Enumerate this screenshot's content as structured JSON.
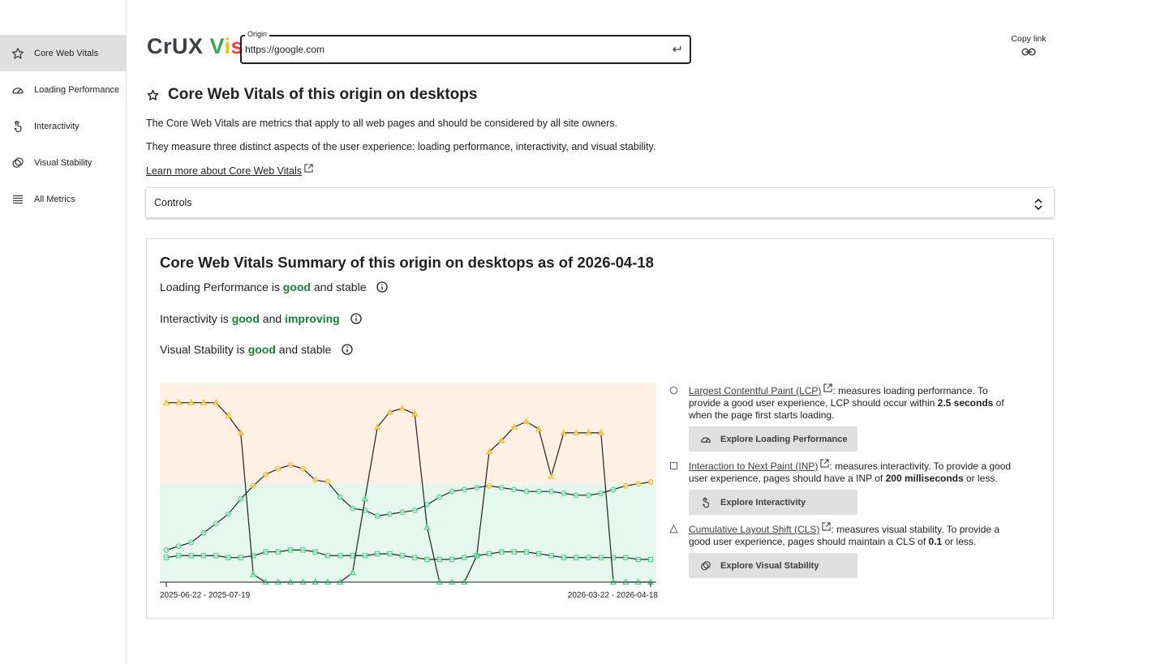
{
  "sidebar": {
    "items": [
      {
        "label": "Core Web Vitals",
        "icon": "star-icon",
        "active": true
      },
      {
        "label": "Loading Performance",
        "icon": "speedometer-icon"
      },
      {
        "label": "Interactivity",
        "icon": "touch-hand-icon"
      },
      {
        "label": "Visual Stability",
        "icon": "overlapping-circles-icon"
      },
      {
        "label": "All Metrics",
        "icon": "list-icon"
      }
    ]
  },
  "header": {
    "logo": {
      "part1": "CrUX ",
      "v": "V",
      "i": "i",
      "s": "s"
    },
    "origin_label": "Origin",
    "origin_value": "https://google.com",
    "copy_link_label": "Copy link"
  },
  "main": {
    "title": "Core Web Vitals of this origin on desktops",
    "para1": "The Core Web Vitals are metrics that apply to all web pages and should be considered by all site owners.",
    "para2": "They measure three distinct aspects of the user experience: loading performance, interactivity, and visual stability.",
    "learn_more": "Learn more about Core Web Vitals",
    "controls_label": "Controls"
  },
  "summary": {
    "title": "Core Web Vitals Summary of this origin on desktops as of 2026-04-18",
    "rows": [
      {
        "pre": "Loading Performance is ",
        "w1": "good",
        "mid": " and stable",
        "w2": ""
      },
      {
        "pre": "Interactivity is ",
        "w1": "good",
        "mid": " and ",
        "w2": "improving"
      },
      {
        "pre": "Visual Stability is ",
        "w1": "good",
        "mid": " and stable",
        "w2": ""
      }
    ]
  },
  "metrics": [
    {
      "link": "Largest Contentful Paint (LCP)",
      "t1": ": measures loading performance. To provide a good user experience, LCP should occur within ",
      "bold": "2.5 seconds",
      "t2": " of when the page first starts loading.",
      "button": "Explore Loading Performance",
      "marker": "circle"
    },
    {
      "link": "Interaction to Next Paint (INP)",
      "t1": ": measures interactivity. To provide a good user experience, pages should have a INP of ",
      "bold": "200 milliseconds",
      "t2": " or less.",
      "button": "Explore Interactivity",
      "marker": "square"
    },
    {
      "link": "Cumulative Layout Shift (CLS)",
      "t1": ": measures visual stability. To provide a good user experience, pages should maintain a CLS of ",
      "bold": "0.1",
      "t2": " or less.",
      "button": "Explore Visual Stability",
      "marker": "triangle"
    }
  ],
  "colors": {
    "good": "#188038",
    "good_band": "#e6f7ef",
    "needs_band": "#fdf1e6",
    "series_good": "#3ddc84",
    "series_warn": "#fbbc04"
  },
  "chart_data": {
    "type": "line",
    "x_first_label": "2025-06-22 - 2025-07-19",
    "x_last_label": "2026-03-22 - 2026-04-18",
    "num_points": 40,
    "series": [
      {
        "marker": "circle",
        "values": [
          0.17,
          0.19,
          0.21,
          0.26,
          0.31,
          0.36,
          0.44,
          0.51,
          0.57,
          0.6,
          0.62,
          0.6,
          0.54,
          0.53,
          0.45,
          0.39,
          0.38,
          0.35,
          0.36,
          0.37,
          0.38,
          0.41,
          0.45,
          0.48,
          0.49,
          0.5,
          0.51,
          0.5,
          0.49,
          0.48,
          0.48,
          0.48,
          0.47,
          0.46,
          0.46,
          0.47,
          0.49,
          0.51,
          0.52,
          0.53
        ]
      },
      {
        "marker": "square",
        "values": [
          0.13,
          0.14,
          0.14,
          0.14,
          0.14,
          0.13,
          0.13,
          0.14,
          0.16,
          0.16,
          0.17,
          0.17,
          0.16,
          0.14,
          0.14,
          0.14,
          0.14,
          0.15,
          0.15,
          0.14,
          0.13,
          0.12,
          0.12,
          0.12,
          0.13,
          0.14,
          0.15,
          0.16,
          0.16,
          0.16,
          0.15,
          0.14,
          0.13,
          0.13,
          0.13,
          0.13,
          0.13,
          0.13,
          0.12,
          0.12
        ]
      },
      {
        "marker": "triangle",
        "values": [
          0.95,
          0.95,
          0.95,
          0.95,
          0.95,
          0.88,
          0.79,
          0.04,
          0.0,
          0.0,
          0.0,
          0.0,
          0.0,
          0.0,
          0.0,
          0.05,
          0.44,
          0.82,
          0.9,
          0.92,
          0.89,
          0.29,
          0.0,
          0.0,
          0.0,
          0.14,
          0.69,
          0.75,
          0.82,
          0.85,
          0.81,
          0.56,
          0.79,
          0.79,
          0.79,
          0.79,
          0.0,
          0.0,
          0.0,
          0.0
        ]
      }
    ],
    "bands": [
      {
        "name": "good",
        "from": 0.0,
        "to": 0.5
      },
      {
        "name": "needs-improvement",
        "from": 0.5,
        "to": 1.0
      }
    ]
  }
}
